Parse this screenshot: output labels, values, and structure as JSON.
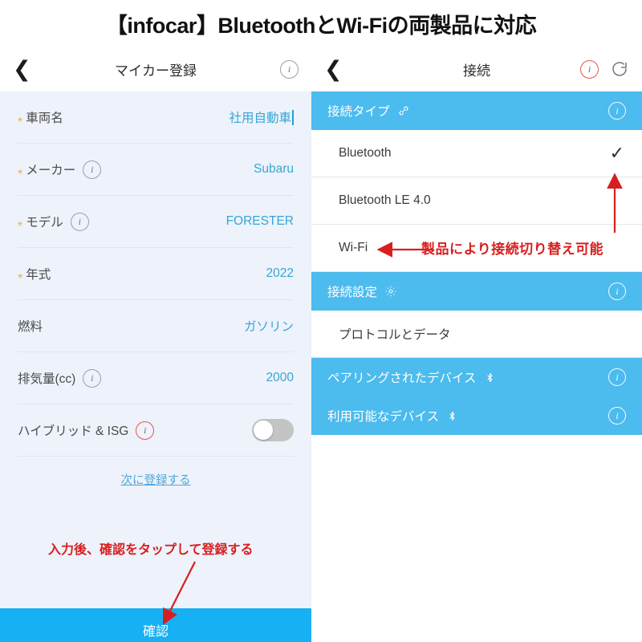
{
  "banner": {
    "title": "【infocar】BluetoothとWi-Fiの両製品に対応"
  },
  "left_panel": {
    "navbar": {
      "back_icon": "chevron-left-icon",
      "title": "マイカー登録",
      "info_icon": "info-circle-icon"
    },
    "form_rows": [
      {
        "label": "車両名",
        "required": true,
        "has_info": false,
        "value": "社用自動車",
        "type": "text-cursor"
      },
      {
        "label": "メーカー",
        "required": true,
        "has_info": true,
        "value": "Subaru",
        "type": "text"
      },
      {
        "label": "モデル",
        "required": true,
        "has_info": true,
        "value": "FORESTER",
        "type": "text"
      },
      {
        "label": "年式",
        "required": true,
        "has_info": false,
        "value": "2022",
        "type": "text"
      },
      {
        "label": "燃料",
        "required": false,
        "has_info": false,
        "value": "ガソリン",
        "type": "text"
      },
      {
        "label": "排気量(cc)",
        "required": false,
        "has_info": true,
        "value": "2000",
        "type": "text"
      },
      {
        "label": "ハイブリッド & ISG",
        "required": false,
        "has_info": true,
        "value": "off",
        "type": "toggle"
      }
    ],
    "next_link": "次に登録する",
    "confirm_button": "確認",
    "annotation": "入力後、確認をタップして登録する"
  },
  "right_panel": {
    "navbar": {
      "back_icon": "chevron-left-icon",
      "title": "接続",
      "info_icon": "info-circle-icon",
      "refresh_icon": "refresh-icon"
    },
    "sections": [
      {
        "title": "接続タイプ",
        "icon": "link-icon",
        "info_icon": "info-circle-icon",
        "options": [
          {
            "label": "Bluetooth",
            "selected": true,
            "check": "✓"
          },
          {
            "label": "Bluetooth LE 4.0",
            "selected": false,
            "check": ""
          },
          {
            "label": "Wi-Fi",
            "selected": false,
            "check": ""
          }
        ]
      },
      {
        "title": "接続設定",
        "icon": "gear-icon",
        "info_icon": "info-circle-icon",
        "options": [
          {
            "label": "プロトコルとデータ",
            "selected": false,
            "check": ""
          }
        ]
      },
      {
        "title": "ペアリングされたデバイス",
        "icon": "bluetooth-icon",
        "info_icon": "info-circle-icon",
        "options": []
      },
      {
        "title": "利用可能なデバイス",
        "icon": "bluetooth-icon",
        "info_icon": "info-circle-icon",
        "options": []
      }
    ],
    "annotation": "製品により接続切り替え可能"
  },
  "colors": {
    "accent_blue": "#4cbbee",
    "confirm_blue": "#17b0f3",
    "value_blue": "#36a6d4",
    "panel_bg": "#eef2fb",
    "annotation_red": "#d81f1f",
    "required_star": "#f0b13a"
  }
}
